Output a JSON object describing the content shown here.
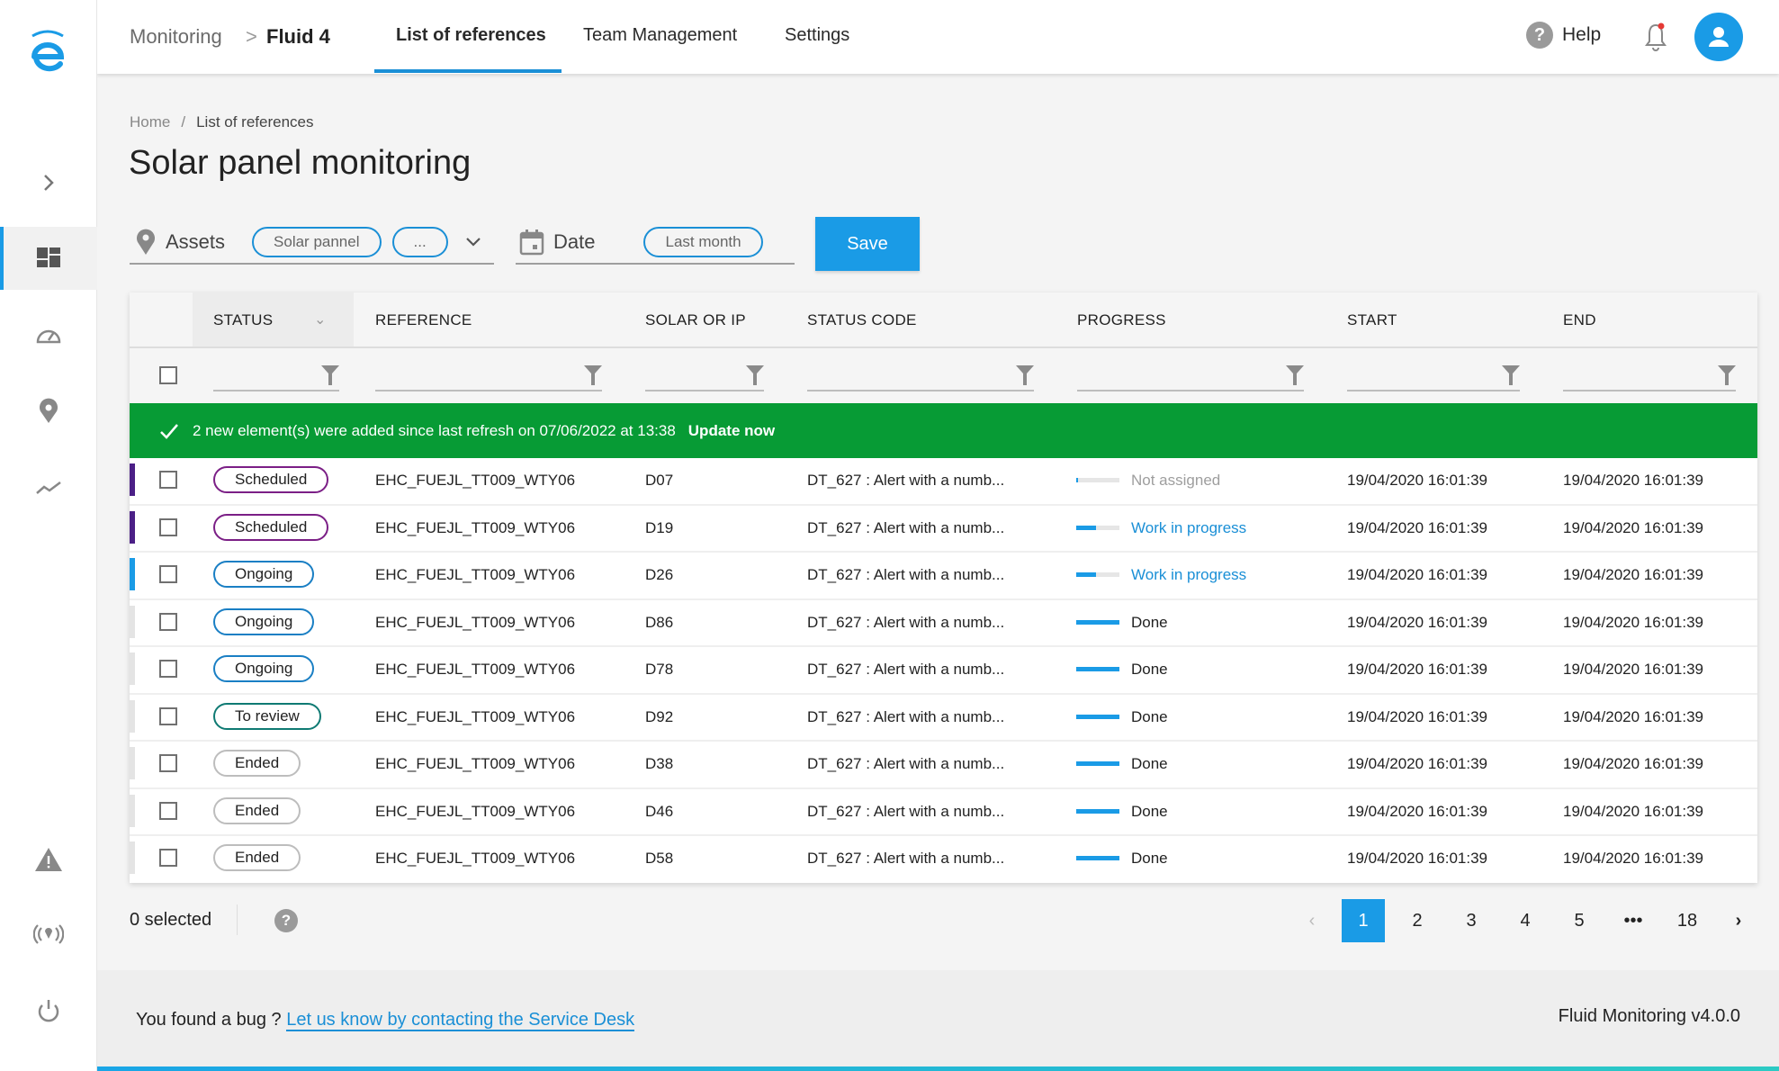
{
  "header": {
    "app_name": "Monitoring",
    "separator": ">",
    "project": "Fluid 4",
    "tabs": [
      {
        "label": "List of references",
        "active": true
      },
      {
        "label": "Team Management",
        "active": false
      },
      {
        "label": "Settings",
        "active": false
      }
    ],
    "help_label": "Help",
    "help_icon": "question-circle-icon",
    "notification_icon": "bell-icon",
    "notification_dot_color": "#e53935",
    "avatar_icon": "user-icon"
  },
  "sidebar": {
    "logo": "e-logo",
    "items": [
      {
        "icon": "chevron-right-icon",
        "active": false
      },
      {
        "icon": "dashboard-icon",
        "active": true
      },
      {
        "icon": "speedometer-icon",
        "active": false
      },
      {
        "icon": "location-pin-icon",
        "active": false
      },
      {
        "icon": "trend-line-icon",
        "active": false
      },
      {
        "icon": "warning-icon",
        "active": false
      },
      {
        "icon": "broadcast-icon",
        "active": false
      },
      {
        "icon": "power-icon",
        "active": false
      }
    ]
  },
  "breadcrumb": {
    "home": "Home",
    "separator": "/",
    "current": "List of references"
  },
  "page_title": "Solar panel monitoring",
  "filters": {
    "assets": {
      "label": "Assets",
      "chips": [
        "Solar pannel",
        "..."
      ]
    },
    "date": {
      "label": "Date",
      "chips": [
        "Last month"
      ]
    },
    "save_label": "Save"
  },
  "table": {
    "columns": [
      "STATUS",
      "REFERENCE",
      "SOLAR OR IP",
      "STATUS CODE",
      "PROGRESS",
      "START",
      "END"
    ],
    "banner": {
      "message": "2 new element(s) were added since last refresh on 07/06/2022 at 13:38",
      "action": "Update now",
      "color": "#079b35"
    },
    "status_colors": {
      "Scheduled": "#7b1f86",
      "Ongoing": "#1a7fc4",
      "To review": "#0f7a73",
      "Ended": "#bdbdbd"
    },
    "accent_colors": {
      "Scheduled": "#4b1f86",
      "Ongoing": "#1a9be6",
      "default": "#e4e4e4"
    },
    "rows": [
      {
        "status": "Scheduled",
        "reference": "EHC_FUEJL_TT009_WTY06",
        "solar": "D07",
        "code": "DT_627 : Alert with a numb...",
        "progress": 0.02,
        "progress_label": "Not assigned",
        "start": "19/04/2020 16:01:39",
        "end": "19/04/2020 16:01:39",
        "accent": "Scheduled"
      },
      {
        "status": "Scheduled",
        "reference": "EHC_FUEJL_TT009_WTY06",
        "solar": "D19",
        "code": "DT_627 : Alert with a numb...",
        "progress": 0.45,
        "progress_label": "Work in progress",
        "start": "19/04/2020 16:01:39",
        "end": "19/04/2020 16:01:39",
        "accent": "Scheduled"
      },
      {
        "status": "Ongoing",
        "reference": "EHC_FUEJL_TT009_WTY06",
        "solar": "D26",
        "code": "DT_627 : Alert with a numb...",
        "progress": 0.45,
        "progress_label": "Work in progress",
        "start": "19/04/2020 16:01:39",
        "end": "19/04/2020 16:01:39",
        "accent": "Ongoing"
      },
      {
        "status": "Ongoing",
        "reference": "EHC_FUEJL_TT009_WTY06",
        "solar": "D86",
        "code": "DT_627 : Alert with a numb...",
        "progress": 1,
        "progress_label": "Done",
        "start": "19/04/2020 16:01:39",
        "end": "19/04/2020 16:01:39",
        "accent": "default"
      },
      {
        "status": "Ongoing",
        "reference": "EHC_FUEJL_TT009_WTY06",
        "solar": "D78",
        "code": "DT_627 : Alert with a numb...",
        "progress": 1,
        "progress_label": "Done",
        "start": "19/04/2020 16:01:39",
        "end": "19/04/2020 16:01:39",
        "accent": "default"
      },
      {
        "status": "To review",
        "reference": "EHC_FUEJL_TT009_WTY06",
        "solar": "D92",
        "code": "DT_627 : Alert with a numb...",
        "progress": 1,
        "progress_label": "Done",
        "start": "19/04/2020 16:01:39",
        "end": "19/04/2020 16:01:39",
        "accent": "default"
      },
      {
        "status": "Ended",
        "reference": "EHC_FUEJL_TT009_WTY06",
        "solar": "D38",
        "code": "DT_627 : Alert with a numb...",
        "progress": 1,
        "progress_label": "Done",
        "start": "19/04/2020 16:01:39",
        "end": "19/04/2020 16:01:39",
        "accent": "default"
      },
      {
        "status": "Ended",
        "reference": "EHC_FUEJL_TT009_WTY06",
        "solar": "D46",
        "code": "DT_627 : Alert with a numb...",
        "progress": 1,
        "progress_label": "Done",
        "start": "19/04/2020 16:01:39",
        "end": "19/04/2020 16:01:39",
        "accent": "default"
      },
      {
        "status": "Ended",
        "reference": "EHC_FUEJL_TT009_WTY06",
        "solar": "D58",
        "code": "DT_627 : Alert with a numb...",
        "progress": 1,
        "progress_label": "Done",
        "start": "19/04/2020 16:01:39",
        "end": "19/04/2020 16:01:39",
        "accent": "default"
      }
    ],
    "progress_label_colors": {
      "Not assigned": "#9e9e9e",
      "Work in progress": "#1a8fd6",
      "Done": "#222222"
    }
  },
  "selection": {
    "label": "0 selected",
    "help_icon": "question-circle-icon"
  },
  "pagination": {
    "prev": "‹",
    "pages": [
      "1",
      "2",
      "3",
      "4",
      "5",
      "•••",
      "18"
    ],
    "current": "1",
    "next": "›"
  },
  "footer": {
    "bug_text": "You found a bug ?",
    "link_text": "Let us know by contacting the Service Desk",
    "version": "Fluid Monitoring v4.0.0"
  },
  "brand_color": "#1a9be6"
}
